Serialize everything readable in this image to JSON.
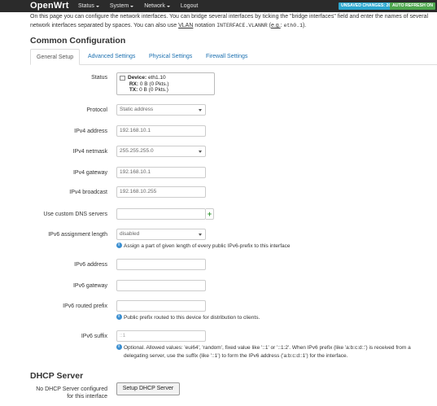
{
  "header": {
    "brand": "OpenWrt",
    "nav": [
      "Status",
      "System",
      "Network",
      "Logout"
    ],
    "unsaved": "UNSAVED CHANGES: 26",
    "refresh": "AUTO REFRESH ON"
  },
  "intro": {
    "line1": "On this page you can configure the network interfaces. You can bridge several interfaces by ticking the \"bridge interfaces\" field and enter the names of several",
    "line2_pre": "network interfaces separated by spaces. You can also use",
    "vlan": "VLAN",
    "notation": "notation",
    "code1": "INTERFACE.VLANNR",
    "eg_pre": "(",
    "eg": "e.g.",
    "colon": ":",
    "code2": "eth0.1",
    "eg_post": ")."
  },
  "common_title": "Common Configuration",
  "tabs": [
    "General Setup",
    "Advanced Settings",
    "Physical Settings",
    "Firewall Settings"
  ],
  "status": {
    "label": "Status",
    "device_key": "Device:",
    "device_val": "eth1.10",
    "rx_key": "RX:",
    "rx_val": "0 B (0 Pkts.)",
    "tx_key": "TX:",
    "tx_val": "0 B (0 Pkts.)"
  },
  "fields": {
    "protocol": {
      "label": "Protocol",
      "value": "Static address"
    },
    "ipv4_address": {
      "label": "IPv4 address",
      "value": "192.168.10.1"
    },
    "ipv4_netmask": {
      "label": "IPv4 netmask",
      "value": "255.255.255.0"
    },
    "ipv4_gateway": {
      "label": "IPv4 gateway",
      "value": "192.168.10.1"
    },
    "ipv4_broadcast": {
      "label": "IPv4 broadcast",
      "value": "192.168.10.255"
    },
    "dns": {
      "label": "Use custom DNS servers",
      "value": ""
    },
    "ipv6_assign": {
      "label": "IPv6 assignment length",
      "value": "disabled",
      "hint": "Assign a part of given length of every public IPv6-prefix to this interface"
    },
    "ipv6_address": {
      "label": "IPv6 address",
      "value": ""
    },
    "ipv6_gateway": {
      "label": "IPv6 gateway",
      "value": ""
    },
    "ipv6_prefix": {
      "label": "IPv6 routed prefix",
      "value": "",
      "hint": "Public prefix routed to this device for distribution to clients."
    },
    "ipv6_suffix": {
      "label": "IPv6 suffix",
      "placeholder": "::1",
      "hint1": "Optional. Allowed values: 'eui64', 'random', fixed value like '::1' or '::1:2'. When IPv6 prefix (like 'a:b:c:d::') is received from a",
      "hint2": "delegating server, use the suffix (like '::1') to form the IPv6 address ('a:b:c:d::1') for the interface."
    }
  },
  "dhcp": {
    "title": "DHCP Server",
    "label1": "No DHCP Server configured",
    "label2": "for this interface",
    "button": "Setup DHCP Server"
  }
}
